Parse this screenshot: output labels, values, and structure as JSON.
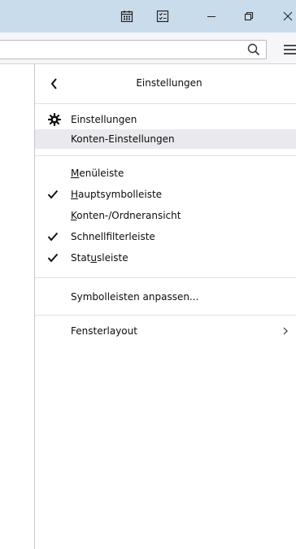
{
  "panel": {
    "title": "Einstellungen",
    "items": [
      {
        "id": "einstellungen",
        "label": "Einstellungen",
        "icon": "gear-icon"
      },
      {
        "id": "konten",
        "label": "Konten-Einstellungen",
        "highlighted": true
      },
      {
        "id": "menueleiste",
        "pre": "",
        "key": "M",
        "post": "enüleiste",
        "checked": false
      },
      {
        "id": "hauptsymbolleiste",
        "pre": "",
        "key": "H",
        "post": "auptsymbolleiste",
        "checked": true
      },
      {
        "id": "ordneransicht",
        "pre": "",
        "key": "K",
        "post": "onten-/Ordneransicht",
        "checked": false
      },
      {
        "id": "schnellfilter",
        "label": "Schnellfilterleiste",
        "checked": true
      },
      {
        "id": "statusleiste",
        "pre": "Stat",
        "key": "u",
        "post": "sleiste",
        "checked": true
      },
      {
        "id": "symbolleisten",
        "label": "Symbolleisten anpassen..."
      },
      {
        "id": "fensterlayout",
        "label": "Fensterlayout",
        "submenu": true
      }
    ]
  },
  "icons": {
    "calendar": "calendar-icon",
    "tasks": "tasks-icon",
    "minimize": "minimize-icon",
    "restore": "restore-icon",
    "close": "close-icon",
    "search": "search-icon",
    "menu": "hamburger-menu-icon",
    "back": "back-arrow-icon",
    "submenu": "chevron-right-icon",
    "check": "checkmark-icon"
  },
  "colors": {
    "titlebar": "#c9dcec",
    "toolbar": "#f6f6f8",
    "hover": "#eaeaee"
  }
}
